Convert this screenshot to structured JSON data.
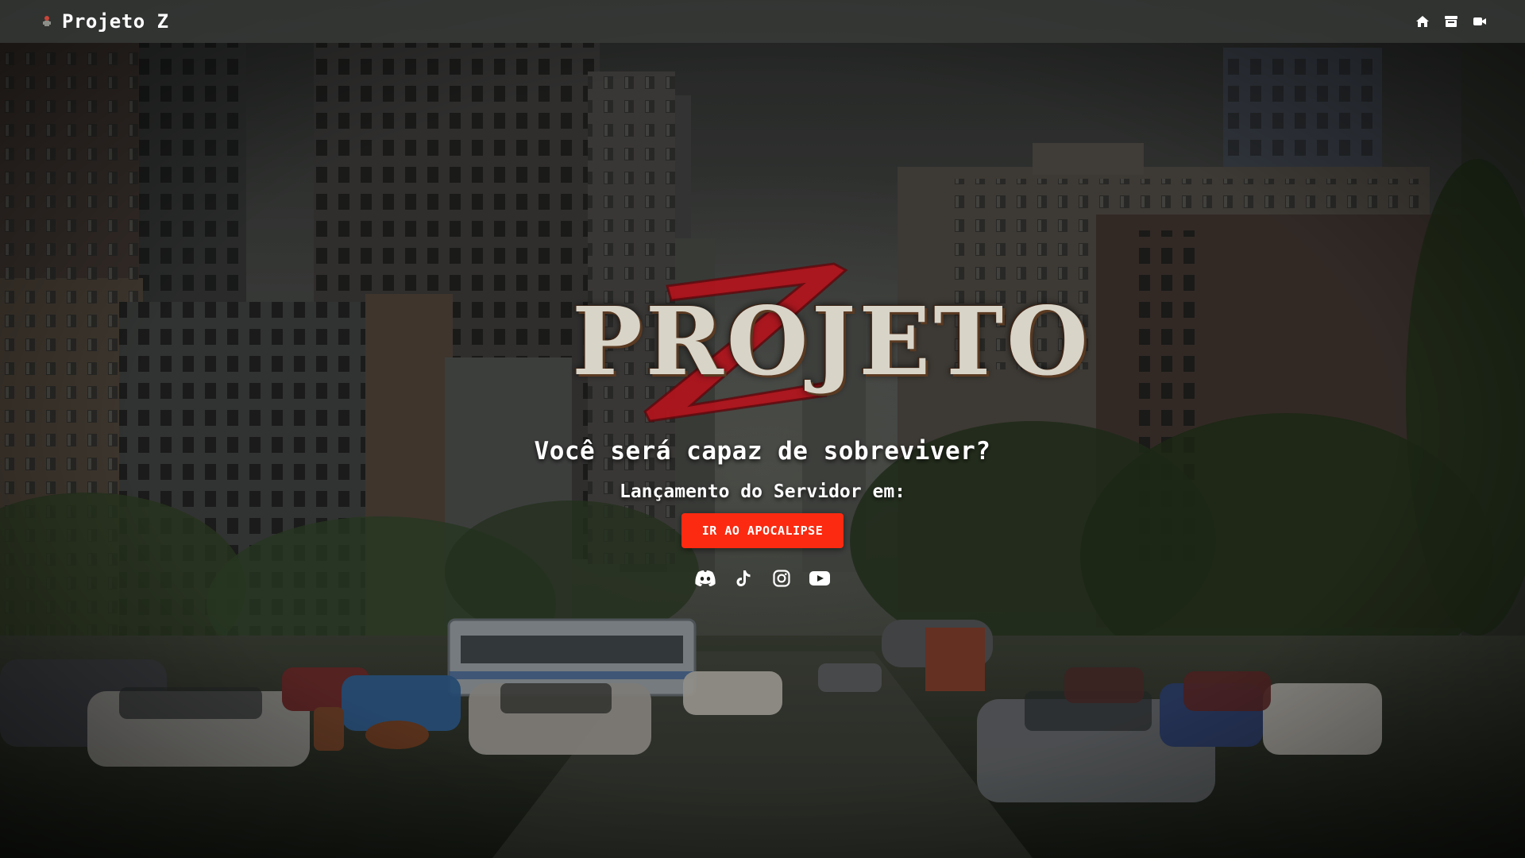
{
  "navbar": {
    "brand_name": "Projeto Z",
    "brand_icon": "zombie-icon",
    "icons": [
      "home-icon",
      "store-icon",
      "video-icon"
    ]
  },
  "hero": {
    "logo_text": "PROJETO",
    "logo_letter": "Z",
    "tagline": "Você será capaz de sobreviver?",
    "launch_text": "Lançamento do Servidor em:",
    "cta_label": "IR AO APOCALIPSE",
    "socials": [
      "discord-icon",
      "tiktok-icon",
      "instagram-icon",
      "youtube-icon"
    ]
  },
  "colors": {
    "accent": "#fb2a10",
    "logo_red": "#b3141c",
    "navbar": "#3a3c3a"
  }
}
